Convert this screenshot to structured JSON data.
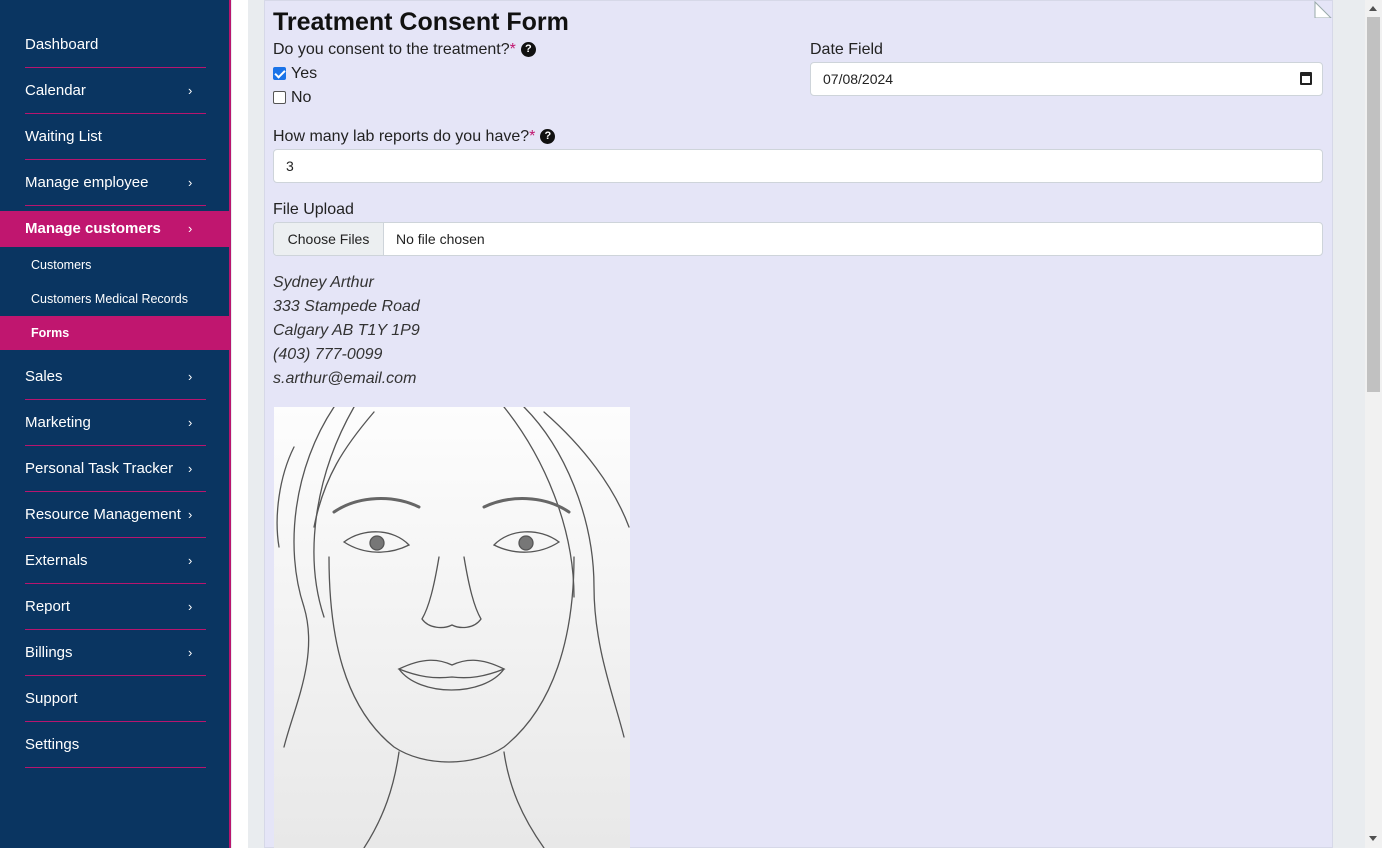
{
  "sidebar": {
    "items": [
      {
        "label": "Dashboard",
        "has_chevron": false
      },
      {
        "label": "Calendar",
        "has_chevron": true
      },
      {
        "label": "Waiting List",
        "has_chevron": false
      },
      {
        "label": "Manage employee",
        "has_chevron": true
      },
      {
        "label": "Manage customers",
        "has_chevron": true,
        "active": true
      },
      {
        "label": "Sales",
        "has_chevron": true
      },
      {
        "label": "Marketing",
        "has_chevron": true
      },
      {
        "label": "Personal Task Tracker",
        "has_chevron": true
      },
      {
        "label": "Resource Management",
        "has_chevron": true
      },
      {
        "label": "Externals",
        "has_chevron": true
      },
      {
        "label": "Report",
        "has_chevron": true
      },
      {
        "label": "Billings",
        "has_chevron": true
      },
      {
        "label": "Support",
        "has_chevron": false
      },
      {
        "label": "Settings",
        "has_chevron": false
      }
    ],
    "sub_items": [
      {
        "label": "Customers"
      },
      {
        "label": "Customers Medical Records"
      },
      {
        "label": "Forms",
        "active": true
      }
    ],
    "chevron": "›"
  },
  "form": {
    "title": "Treatment Consent Form",
    "consent_question": "Do you consent to the treatment?",
    "required_mark": "*",
    "help_glyph": "?",
    "options": [
      {
        "label": "Yes",
        "checked": true
      },
      {
        "label": "No",
        "checked": false
      }
    ],
    "date_label": "Date Field",
    "date_value": "07/08/2024",
    "lab_question": "How many lab reports do you have?",
    "lab_value": "3",
    "file_label": "File Upload",
    "file_button": "Choose Files",
    "file_status": "No file chosen",
    "address": [
      "Sydney Arthur",
      "333 Stampede Road",
      "Calgary AB T1Y 1P9",
      "(403) 777-0099",
      "s.arthur@email.com"
    ]
  },
  "colors": {
    "sidebar_bg": "#0a3561",
    "accent": "#c0166f",
    "form_bg": "#e5e5f7"
  }
}
